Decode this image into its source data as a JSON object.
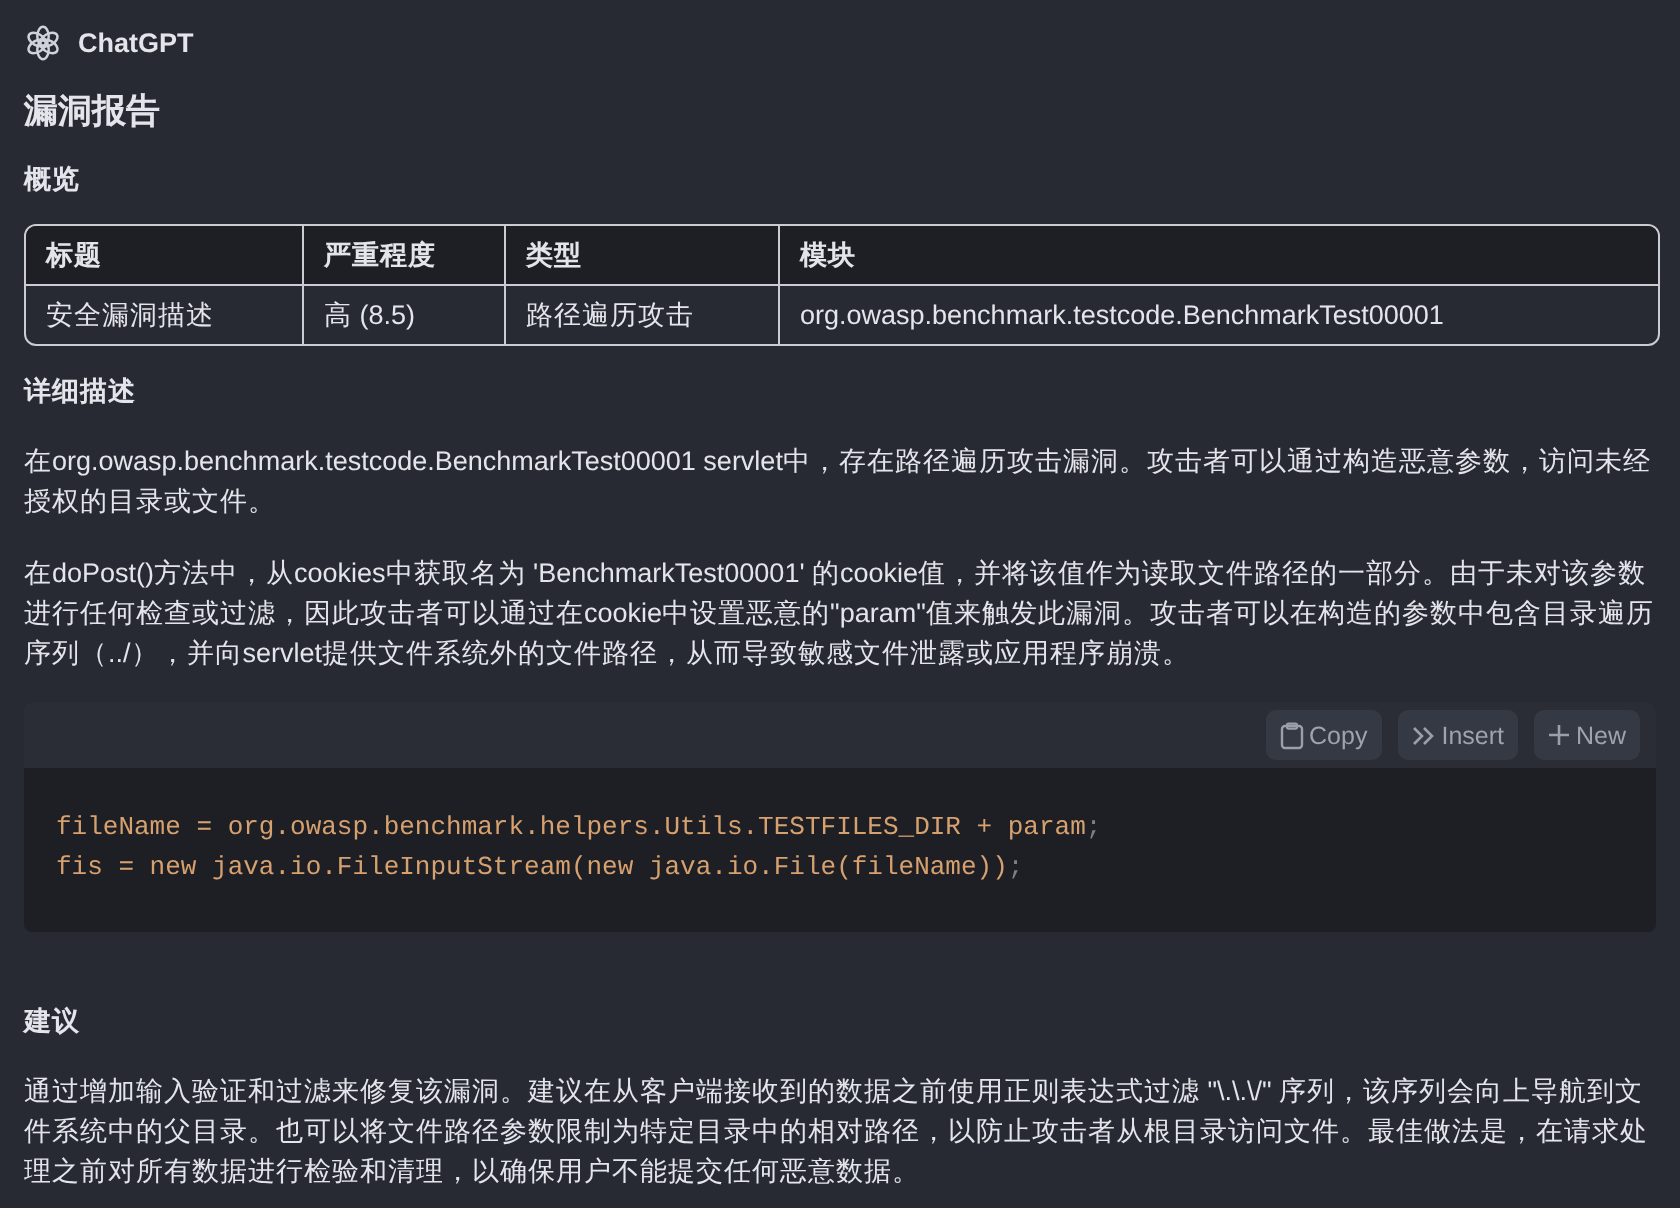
{
  "header": {
    "app_name": "ChatGPT"
  },
  "title": "漏洞报告",
  "overview": {
    "heading": "概览",
    "columns": [
      "标题",
      "严重程度",
      "类型",
      "模块"
    ],
    "rows": [
      [
        "安全漏洞描述",
        "高 (8.5)",
        "路径遍历攻击",
        "org.owasp.benchmark.testcode.BenchmarkTest00001"
      ]
    ]
  },
  "details": {
    "heading": "详细描述",
    "paragraphs": [
      "在org.owasp.benchmark.testcode.BenchmarkTest00001 servlet中，存在路径遍历攻击漏洞。攻击者可以通过构造恶意参数，访问未经授权的目录或文件。",
      "在doPost()方法中，从cookies中获取名为 'BenchmarkTest00001' 的cookie值，并将该值作为读取文件路径的一部分。由于未对该参数进行任何检查或过滤，因此攻击者可以通过在cookie中设置恶意的\"param\"值来触发此漏洞。攻击者可以在构造的参数中包含目录遍历序列（../），并向servlet提供文件系统外的文件路径，从而导致敏感文件泄露或应用程序崩溃。"
    ]
  },
  "code_block": {
    "actions": [
      {
        "kind": "copy",
        "label": "Copy"
      },
      {
        "kind": "insert",
        "label": "Insert"
      },
      {
        "kind": "new",
        "label": "New"
      }
    ],
    "lines": [
      [
        {
          "kind": "code",
          "text": "fileName = org.owasp.benchmark.helpers.Utils.TESTFILES_DIR + param"
        },
        {
          "kind": "punct",
          "text": ";"
        }
      ],
      [
        {
          "kind": "code",
          "text": "fis = new java.io.FileInputStream(new java.io.File(fileName))"
        },
        {
          "kind": "punct",
          "text": ";"
        }
      ]
    ]
  },
  "recommendation": {
    "heading": "建议",
    "paragraph": "通过增加输入验证和过滤来修复该漏洞。建议在从客户端接收到的数据之前使用正则表达式过滤 \"\\.\\.\\/\" 序列，该序列会向上导航到文件系统中的父目录。也可以将文件路径参数限制为特定目录中的相对路径，以防止攻击者从根目录访问文件。最佳做法是，在请求处理之前对所有数据进行检验和清理，以确保用户不能提交任何恶意数据。"
  }
}
